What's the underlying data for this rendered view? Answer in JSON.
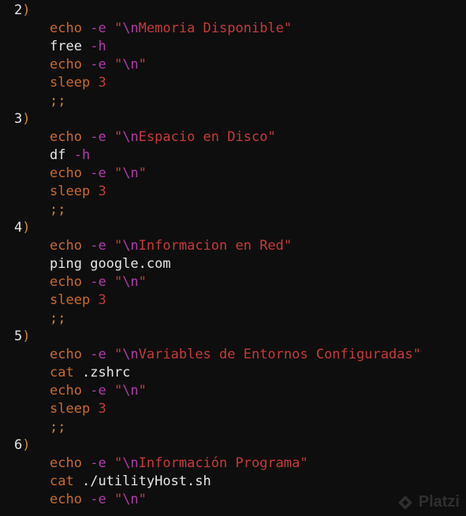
{
  "editor": {
    "blocks": [
      {
        "number": "2",
        "paren": ")",
        "title_escape": "\\n",
        "title_text": "Memoria Disponible",
        "command": {
          "cmd": "free",
          "arg": "-h",
          "cmd_style": "plain",
          "arg_style": "flag"
        }
      },
      {
        "number": "3",
        "paren": ")",
        "title_escape": "\\n",
        "title_text": "Espacio en Disco",
        "command": {
          "cmd": "df",
          "arg": "-h",
          "cmd_style": "plain",
          "arg_style": "flag"
        }
      },
      {
        "number": "4",
        "paren": ")",
        "title_escape": "\\n",
        "title_text": "Informacion en Red",
        "command": {
          "cmd": "ping",
          "arg": "google.com",
          "cmd_style": "plain",
          "arg_style": "plain"
        }
      },
      {
        "number": "5",
        "paren": ")",
        "title_escape": "\\n",
        "title_text": "Variables de Entornos Configuradas",
        "command": {
          "cmd": "cat",
          "arg": ".zshrc",
          "cmd_style": "kw",
          "arg_style": "plain"
        }
      },
      {
        "number": "6",
        "paren": ")",
        "title_escape": "\\n",
        "title_text": "Información Programa",
        "command": {
          "cmd": "cat",
          "arg": "./utilityHost.sh",
          "cmd_style": "kw",
          "arg_style": "plain"
        },
        "truncated": true
      }
    ],
    "echo_keyword": "echo",
    "echo_flag": "-e",
    "quote": "\"",
    "newline_escape": "\\n",
    "sleep_keyword": "sleep",
    "sleep_value": "3",
    "terminator": ";;"
  },
  "watermark": {
    "text": "Platzi",
    "icon": "platzi-logo-icon"
  },
  "colors": {
    "background": "#0e0e0e",
    "plain_text": "#e6e6e6",
    "keyword": "#c96a2a",
    "flag": "#b23aab",
    "string": "#c73a3a",
    "escape": "#b23aab",
    "number": "#c73a3a",
    "paren": "#d08a2d"
  }
}
